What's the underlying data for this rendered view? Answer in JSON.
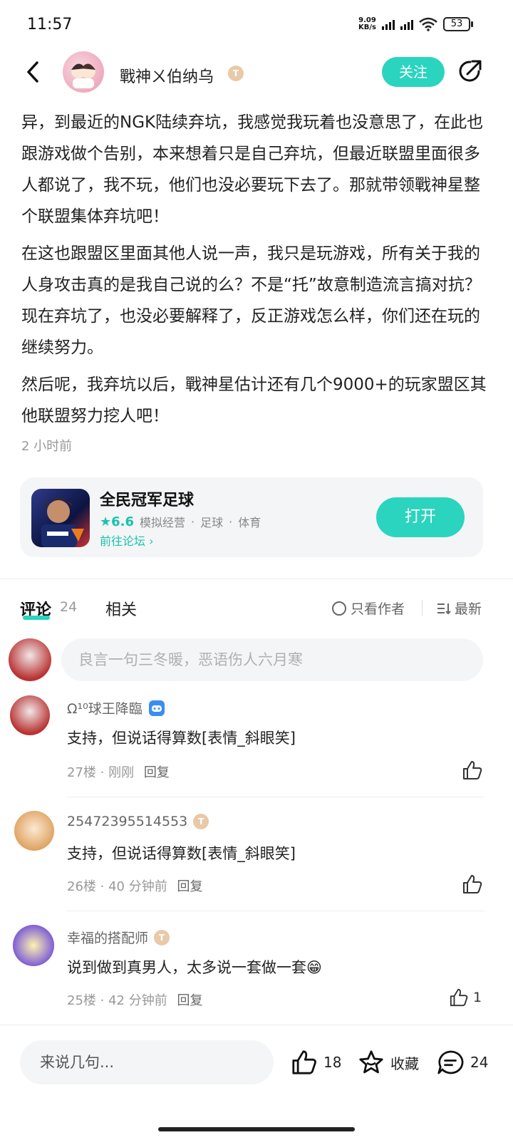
{
  "status_bar": {
    "time": "11:57",
    "net_speed_value": "9.09",
    "net_speed_unit": "KB/s",
    "battery": "53"
  },
  "header": {
    "username": "戰神ㄨ伯纳乌",
    "badge": "T",
    "follow_label": "关注"
  },
  "post": {
    "paragraphs": [
      "异，到最近的NGK陆续弃坑，我感觉我玩着也没意思了，在此也跟游戏做个告别，本来想着只是自己弃坑，但最近联盟里面很多人都说了，我不玩，他们也没必要玩下去了。那就带领戰神星整个联盟集体弃坑吧！",
      "在这也跟盟区里面其他人说一声，我只是玩游戏，所有关于我的人身攻击真的是我自己说的么？不是“托”故意制造流言搞对抗？现在弃坑了，也没必要解释了，反正游戏怎么样，你们还在玩的继续努力。",
      "然后呢，我弃坑以后，戰神星估计还有几个9000+的玩家盟区其他联盟努力挖人吧！"
    ],
    "time_ago": "2 小时前"
  },
  "game_card": {
    "title": "全民冠军足球",
    "rating": "★6.6",
    "tags": [
      "模拟经营",
      "足球",
      "体育"
    ],
    "separator": "·",
    "forum_link": "前往论坛 ›",
    "open_label": "打开"
  },
  "tabs": {
    "comments_label": "评论",
    "comments_count": "24",
    "related_label": "相关",
    "only_author_label": "只看作者",
    "sort_label": "最新"
  },
  "comment_box": {
    "placeholder": "良言一句三冬暖，恶语伤人六月寒"
  },
  "comments": [
    {
      "name": "Ω¹⁰球王降臨",
      "text": "支持，但说话得算数[表情_斜眼笑]",
      "floor": "27楼",
      "time": "刚刚",
      "reply": "回复",
      "likes": ""
    },
    {
      "name": "25472395514553",
      "text": "支持，但说话得算数[表情_斜眼笑]",
      "floor": "26楼",
      "time": "40 分钟前",
      "reply": "回复",
      "likes": ""
    },
    {
      "name": "幸福的搭配师",
      "text": "说到做到真男人，太多说一套做一套😁",
      "floor": "25楼",
      "time": "42 分钟前",
      "reply": "回复",
      "likes": "1"
    }
  ],
  "bottom_bar": {
    "input_label": "来说几句...",
    "like_count": "18",
    "favorite_label": "收藏",
    "comment_count": "24"
  },
  "colors": {
    "accent": "#2bd4bf",
    "accent_text": "#19c2ae"
  }
}
